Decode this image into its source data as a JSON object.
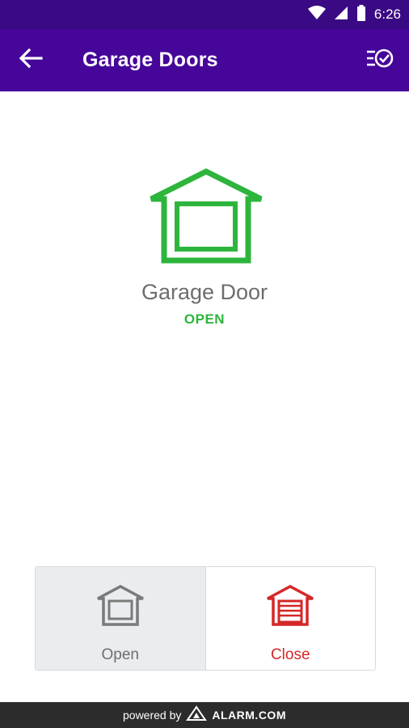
{
  "status_bar": {
    "time": "6:26",
    "icons": [
      "wifi-icon",
      "signal-icon",
      "battery-icon"
    ]
  },
  "app_bar": {
    "title": "Garage Doors",
    "back_icon": "back-arrow-icon",
    "action_icon": "checklist-icon"
  },
  "device": {
    "name": "Garage Door",
    "status": "OPEN",
    "status_color": "#2db53c",
    "icon": "garage-open-icon"
  },
  "controls": {
    "open": {
      "label": "Open",
      "icon": "garage-open-gray-icon"
    },
    "close": {
      "label": "Close",
      "icon": "garage-closed-red-icon",
      "color": "#d42727"
    }
  },
  "footer": {
    "powered_by": "powered by",
    "brand": "ALARM.COM"
  },
  "colors": {
    "app_bar": "#46069a",
    "status_bar": "#3a0a84",
    "footer": "#2c2c2c"
  }
}
